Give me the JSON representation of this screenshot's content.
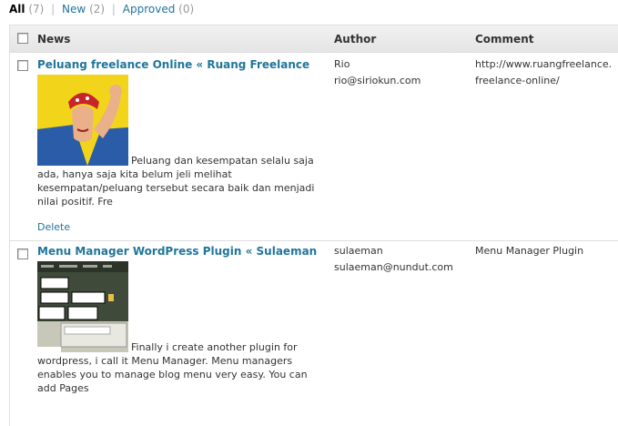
{
  "filters": {
    "all": {
      "label": "All",
      "count": "(7)"
    },
    "new": {
      "label": "New",
      "count": "(2)"
    },
    "approved": {
      "label": "Approved",
      "count": "(0)"
    },
    "separator": "|"
  },
  "table": {
    "headers": {
      "news": "News",
      "author": "Author",
      "comment": "Comment"
    },
    "rows": [
      {
        "title": "Peluang freelance Online « Ruang Freelance",
        "excerpt": "Peluang dan kesempatan selalu saja ada, hanya saja kita belum jeli melihat kesempatan/peluang tersebut secara baik dan menjadi nilai positif. Fre",
        "delete_label": "Delete",
        "author_name": "Rio",
        "author_email": "rio@siriokun.com",
        "comment_line1": "http://www.ruangfreelance.",
        "comment_line2": "freelance-online/"
      },
      {
        "title": "Menu Manager WordPress Plugin « Sulaeman",
        "excerpt": "Finally i create another plugin for wordpress, i call it Menu Manager. Menu managers enables you to manage blog menu very easy. You can add Pages",
        "author_name": "sulaeman",
        "author_email": "sulaeman@nundut.com",
        "comment_line1": "Menu Manager Plugin"
      }
    ]
  },
  "colors": {
    "link": "#21759b",
    "header_bg": "#e4e4e4",
    "border": "#dfdfdf"
  }
}
